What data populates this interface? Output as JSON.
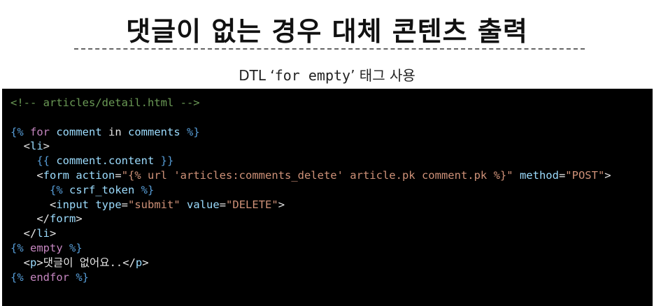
{
  "title": "댓글이 없는 경우 대체 콘텐츠 출력",
  "subtitle": {
    "prefix": "DTL ‘",
    "code": "for empty",
    "suffix": "’ 태그 사용"
  },
  "code_lines": [
    [
      {
        "t": "<!-- articles/detail.html -->",
        "c": "comment"
      }
    ],
    [],
    [
      {
        "t": "{% ",
        "c": "brace"
      },
      {
        "t": "for",
        "c": "kw"
      },
      {
        "t": " comment ",
        "c": "var"
      },
      {
        "t": "in",
        "c": "text"
      },
      {
        "t": " comments ",
        "c": "var"
      },
      {
        "t": "%}",
        "c": "brace"
      }
    ],
    [
      {
        "t": "  <",
        "c": "text"
      },
      {
        "t": "li",
        "c": "tag"
      },
      {
        "t": ">",
        "c": "text"
      }
    ],
    [
      {
        "t": "    {{ ",
        "c": "brace"
      },
      {
        "t": "comment.content",
        "c": "var"
      },
      {
        "t": " }}",
        "c": "brace"
      }
    ],
    [
      {
        "t": "    <",
        "c": "text"
      },
      {
        "t": "form",
        "c": "tag"
      },
      {
        "t": " ",
        "c": "text"
      },
      {
        "t": "action",
        "c": "attr"
      },
      {
        "t": "=",
        "c": "text"
      },
      {
        "t": "\"{% url 'articles:comments_delete' article.pk comment.pk %}\"",
        "c": "str"
      },
      {
        "t": " ",
        "c": "text"
      },
      {
        "t": "method",
        "c": "attr"
      },
      {
        "t": "=",
        "c": "text"
      },
      {
        "t": "\"POST\"",
        "c": "str"
      },
      {
        "t": ">",
        "c": "text"
      }
    ],
    [
      {
        "t": "      {% ",
        "c": "brace"
      },
      {
        "t": "csrf_token",
        "c": "var"
      },
      {
        "t": " %}",
        "c": "brace"
      }
    ],
    [
      {
        "t": "      <",
        "c": "text"
      },
      {
        "t": "input",
        "c": "tag"
      },
      {
        "t": " ",
        "c": "text"
      },
      {
        "t": "type",
        "c": "attr"
      },
      {
        "t": "=",
        "c": "text"
      },
      {
        "t": "\"submit\"",
        "c": "str"
      },
      {
        "t": " ",
        "c": "text"
      },
      {
        "t": "value",
        "c": "attr"
      },
      {
        "t": "=",
        "c": "text"
      },
      {
        "t": "\"DELETE\"",
        "c": "str"
      },
      {
        "t": ">",
        "c": "text"
      }
    ],
    [
      {
        "t": "    </",
        "c": "text"
      },
      {
        "t": "form",
        "c": "tag"
      },
      {
        "t": ">",
        "c": "text"
      }
    ],
    [
      {
        "t": "  </",
        "c": "text"
      },
      {
        "t": "li",
        "c": "tag"
      },
      {
        "t": ">",
        "c": "text"
      }
    ],
    [
      {
        "t": "{% ",
        "c": "brace"
      },
      {
        "t": "empty",
        "c": "kw"
      },
      {
        "t": " %}",
        "c": "brace"
      }
    ],
    [
      {
        "t": "  <",
        "c": "text"
      },
      {
        "t": "p",
        "c": "tag"
      },
      {
        "t": ">",
        "c": "text"
      },
      {
        "t": "댓글이 없어요..",
        "c": "text"
      },
      {
        "t": "</",
        "c": "text"
      },
      {
        "t": "p",
        "c": "tag"
      },
      {
        "t": ">",
        "c": "text"
      }
    ],
    [
      {
        "t": "{% ",
        "c": "brace"
      },
      {
        "t": "endfor",
        "c": "kw"
      },
      {
        "t": " %}",
        "c": "brace"
      }
    ]
  ]
}
